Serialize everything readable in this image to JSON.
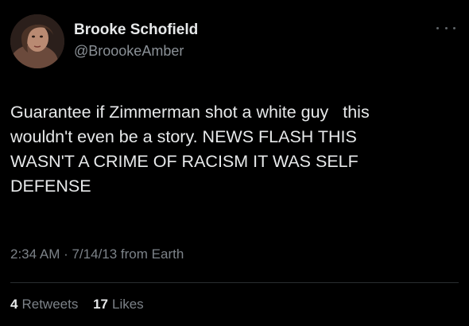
{
  "tweet": {
    "author": {
      "display_name": "Brooke Schofield",
      "handle": "@BroookeAmber"
    },
    "text": "Guarantee if Zimmerman shot a white guy   this\nwouldn't even be a story. NEWS FLASH THIS\nWASN'T A CRIME OF RACISM IT WAS SELF\nDEFENSE",
    "timestamp": "2:34 AM · 7/14/13 from Earth",
    "stats": {
      "retweets_count": "4",
      "retweets_label": "Retweets",
      "likes_count": "17",
      "likes_label": "Likes"
    },
    "icons": {
      "more": "more-options-icon"
    }
  }
}
